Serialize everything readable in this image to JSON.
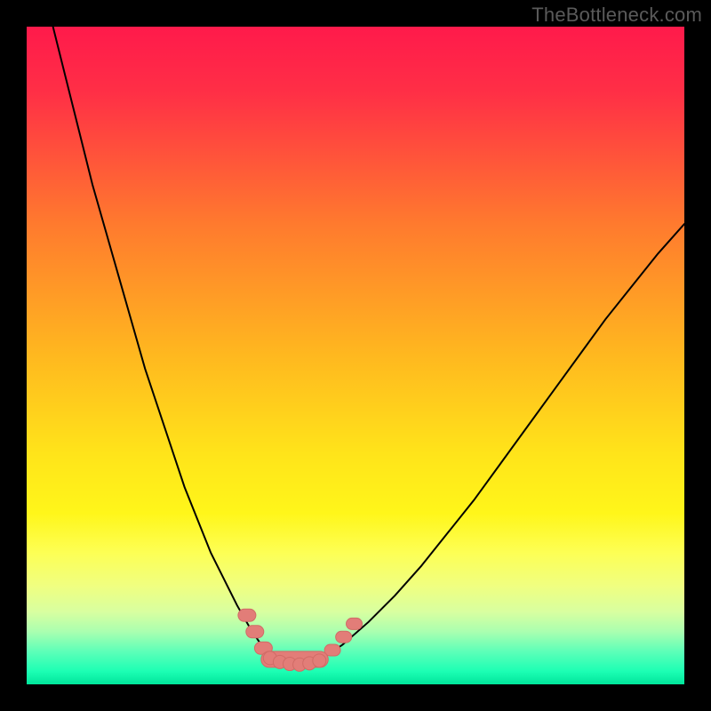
{
  "watermark": "TheBottleneck.com",
  "chart_data": {
    "type": "line",
    "title": "",
    "xlabel": "",
    "ylabel": "",
    "xlim": [
      0,
      100
    ],
    "ylim": [
      0,
      100
    ],
    "grid": false,
    "legend": false,
    "background_gradient_stops": [
      {
        "offset": 0.0,
        "color": "#ff1a4b"
      },
      {
        "offset": 0.1,
        "color": "#ff2f46"
      },
      {
        "offset": 0.3,
        "color": "#ff7a2e"
      },
      {
        "offset": 0.5,
        "color": "#ffb81f"
      },
      {
        "offset": 0.65,
        "color": "#ffe41a"
      },
      {
        "offset": 0.74,
        "color": "#fff61a"
      },
      {
        "offset": 0.8,
        "color": "#fdff55"
      },
      {
        "offset": 0.85,
        "color": "#f0ff80"
      },
      {
        "offset": 0.89,
        "color": "#d8ffa0"
      },
      {
        "offset": 0.92,
        "color": "#aaffb0"
      },
      {
        "offset": 0.95,
        "color": "#5dffb8"
      },
      {
        "offset": 0.98,
        "color": "#1dffb4"
      },
      {
        "offset": 1.0,
        "color": "#00e59b"
      }
    ],
    "series": [
      {
        "name": "left-arm",
        "color": "#000000",
        "width": 2,
        "x": [
          4,
          6,
          8,
          10,
          12,
          14,
          16,
          18,
          20,
          22,
          24,
          26,
          28,
          30,
          32,
          34,
          36,
          37
        ],
        "values": [
          100,
          92,
          84,
          76,
          69,
          62,
          55,
          48,
          42,
          36,
          30,
          25,
          20,
          16,
          12,
          8.5,
          5.5,
          4
        ]
      },
      {
        "name": "right-arm",
        "color": "#000000",
        "width": 2,
        "x": [
          45,
          48,
          52,
          56,
          60,
          64,
          68,
          72,
          76,
          80,
          84,
          88,
          92,
          96,
          100
        ],
        "values": [
          4,
          6,
          9.5,
          13.5,
          18,
          23,
          28,
          33.5,
          39,
          44.5,
          50,
          55.5,
          60.5,
          65.5,
          70
        ]
      }
    ],
    "markers": {
      "shape": "rounded-rect",
      "color": "#e27d78",
      "stroke": "#d16b66",
      "left_cluster": [
        {
          "x": 33.5,
          "y": 10.5
        },
        {
          "x": 34.7,
          "y": 8.0
        },
        {
          "x": 36.0,
          "y": 5.5
        }
      ],
      "valley_track": [
        {
          "x": 37.0,
          "y": 4.0
        },
        {
          "x": 38.5,
          "y": 3.4
        },
        {
          "x": 40.0,
          "y": 3.1
        },
        {
          "x": 41.5,
          "y": 3.0
        },
        {
          "x": 43.0,
          "y": 3.2
        },
        {
          "x": 44.5,
          "y": 3.6
        }
      ],
      "right_cluster": [
        {
          "x": 46.5,
          "y": 5.2
        },
        {
          "x": 48.2,
          "y": 7.2
        },
        {
          "x": 49.8,
          "y": 9.2
        }
      ]
    }
  }
}
